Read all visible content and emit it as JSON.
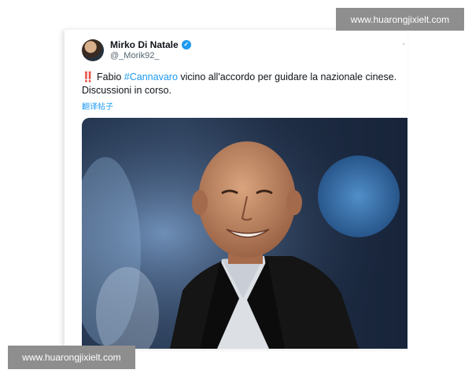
{
  "tweet": {
    "display_name": "Mirko Di Natale",
    "handle": "@_Morik92_",
    "verified_icon": "verified-badge-icon",
    "more_icon": "more-dots-icon",
    "alert_emoji": "‼️",
    "text_before": " Fabio ",
    "hashtag": "#Cannavaro",
    "text_after": " vicino all'accordo per guidare la nazionale cinese.",
    "text_line2": "Discussioni in corso.",
    "translate_label": "翻译帖子",
    "media": "photo of a smiling bald man in a dark suit jacket and checked shirt, stadium background"
  },
  "watermarks": {
    "top": "www.huarongjixielt.com",
    "bottom": "www.huarongjixielt.com"
  },
  "colors": {
    "accent": "#1d9bf0",
    "text": "#0f1419",
    "secondary": "#536471",
    "watermark_bg": "#8e8e8e"
  }
}
